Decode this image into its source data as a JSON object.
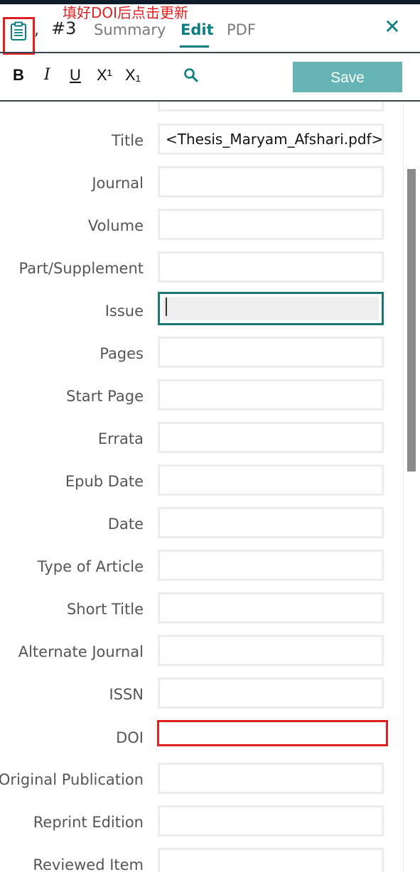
{
  "annotation": "填好DOI后点击更新",
  "header": {
    "comma": ",",
    "ref_number": "#3",
    "tabs": [
      {
        "label": "Summary",
        "active": false
      },
      {
        "label": "Edit",
        "active": true
      },
      {
        "label": "PDF",
        "active": false
      }
    ],
    "close_glyph": "✕"
  },
  "toolbar": {
    "bold": "B",
    "italic": "I",
    "underline": "U",
    "superscript": "X¹",
    "subscript": "X₁",
    "save_label": "Save"
  },
  "form": {
    "fields": [
      {
        "label": "Title",
        "value": "<Thesis_Maryam_Afshari.pdf>"
      },
      {
        "label": "Journal",
        "value": ""
      },
      {
        "label": "Volume",
        "value": ""
      },
      {
        "label": "Part/Supplement",
        "value": ""
      },
      {
        "label": "Issue",
        "value": ""
      },
      {
        "label": "Pages",
        "value": ""
      },
      {
        "label": "Start Page",
        "value": ""
      },
      {
        "label": "Errata",
        "value": ""
      },
      {
        "label": "Epub Date",
        "value": ""
      },
      {
        "label": "Date",
        "value": ""
      },
      {
        "label": "Type of Article",
        "value": ""
      },
      {
        "label": "Short Title",
        "value": ""
      },
      {
        "label": "Alternate Journal",
        "value": ""
      },
      {
        "label": "ISSN",
        "value": ""
      },
      {
        "label": "DOI",
        "value": ""
      },
      {
        "label": "Original Publication",
        "value": ""
      },
      {
        "label": "Reprint Edition",
        "value": ""
      },
      {
        "label": "Reviewed Item",
        "value": ""
      }
    ]
  },
  "colors": {
    "accent": "#0a7d80",
    "save_button": "#66b4b4",
    "annotation_red": "#e02020"
  },
  "icons": {
    "reference": "clipboard-icon",
    "close": "close-icon",
    "search": "search-icon"
  }
}
